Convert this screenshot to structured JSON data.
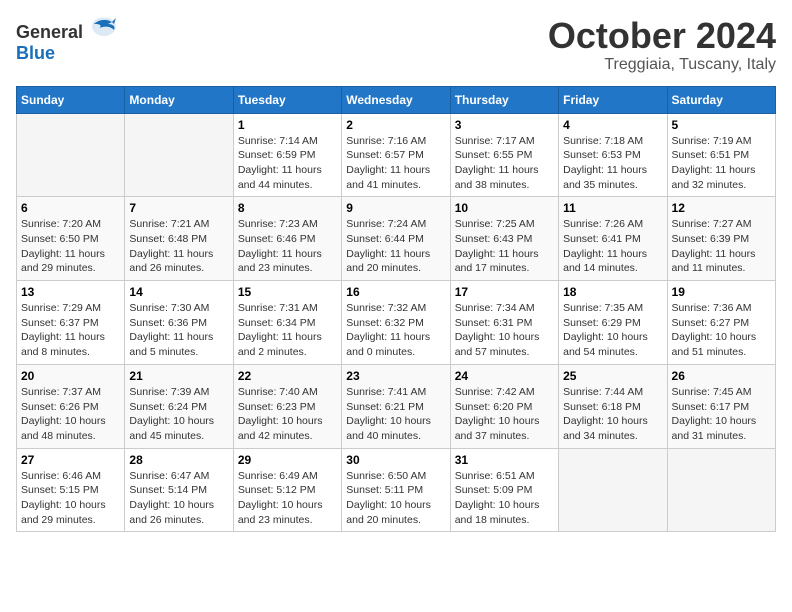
{
  "header": {
    "logo": {
      "general": "General",
      "blue": "Blue"
    },
    "month": "October 2024",
    "location": "Treggiaia, Tuscany, Italy"
  },
  "days_of_week": [
    "Sunday",
    "Monday",
    "Tuesday",
    "Wednesday",
    "Thursday",
    "Friday",
    "Saturday"
  ],
  "weeks": [
    [
      {
        "day": "",
        "info": ""
      },
      {
        "day": "",
        "info": ""
      },
      {
        "day": "1",
        "info": "Sunrise: 7:14 AM\nSunset: 6:59 PM\nDaylight: 11 hours and 44 minutes."
      },
      {
        "day": "2",
        "info": "Sunrise: 7:16 AM\nSunset: 6:57 PM\nDaylight: 11 hours and 41 minutes."
      },
      {
        "day": "3",
        "info": "Sunrise: 7:17 AM\nSunset: 6:55 PM\nDaylight: 11 hours and 38 minutes."
      },
      {
        "day": "4",
        "info": "Sunrise: 7:18 AM\nSunset: 6:53 PM\nDaylight: 11 hours and 35 minutes."
      },
      {
        "day": "5",
        "info": "Sunrise: 7:19 AM\nSunset: 6:51 PM\nDaylight: 11 hours and 32 minutes."
      }
    ],
    [
      {
        "day": "6",
        "info": "Sunrise: 7:20 AM\nSunset: 6:50 PM\nDaylight: 11 hours and 29 minutes."
      },
      {
        "day": "7",
        "info": "Sunrise: 7:21 AM\nSunset: 6:48 PM\nDaylight: 11 hours and 26 minutes."
      },
      {
        "day": "8",
        "info": "Sunrise: 7:23 AM\nSunset: 6:46 PM\nDaylight: 11 hours and 23 minutes."
      },
      {
        "day": "9",
        "info": "Sunrise: 7:24 AM\nSunset: 6:44 PM\nDaylight: 11 hours and 20 minutes."
      },
      {
        "day": "10",
        "info": "Sunrise: 7:25 AM\nSunset: 6:43 PM\nDaylight: 11 hours and 17 minutes."
      },
      {
        "day": "11",
        "info": "Sunrise: 7:26 AM\nSunset: 6:41 PM\nDaylight: 11 hours and 14 minutes."
      },
      {
        "day": "12",
        "info": "Sunrise: 7:27 AM\nSunset: 6:39 PM\nDaylight: 11 hours and 11 minutes."
      }
    ],
    [
      {
        "day": "13",
        "info": "Sunrise: 7:29 AM\nSunset: 6:37 PM\nDaylight: 11 hours and 8 minutes."
      },
      {
        "day": "14",
        "info": "Sunrise: 7:30 AM\nSunset: 6:36 PM\nDaylight: 11 hours and 5 minutes."
      },
      {
        "day": "15",
        "info": "Sunrise: 7:31 AM\nSunset: 6:34 PM\nDaylight: 11 hours and 2 minutes."
      },
      {
        "day": "16",
        "info": "Sunrise: 7:32 AM\nSunset: 6:32 PM\nDaylight: 11 hours and 0 minutes."
      },
      {
        "day": "17",
        "info": "Sunrise: 7:34 AM\nSunset: 6:31 PM\nDaylight: 10 hours and 57 minutes."
      },
      {
        "day": "18",
        "info": "Sunrise: 7:35 AM\nSunset: 6:29 PM\nDaylight: 10 hours and 54 minutes."
      },
      {
        "day": "19",
        "info": "Sunrise: 7:36 AM\nSunset: 6:27 PM\nDaylight: 10 hours and 51 minutes."
      }
    ],
    [
      {
        "day": "20",
        "info": "Sunrise: 7:37 AM\nSunset: 6:26 PM\nDaylight: 10 hours and 48 minutes."
      },
      {
        "day": "21",
        "info": "Sunrise: 7:39 AM\nSunset: 6:24 PM\nDaylight: 10 hours and 45 minutes."
      },
      {
        "day": "22",
        "info": "Sunrise: 7:40 AM\nSunset: 6:23 PM\nDaylight: 10 hours and 42 minutes."
      },
      {
        "day": "23",
        "info": "Sunrise: 7:41 AM\nSunset: 6:21 PM\nDaylight: 10 hours and 40 minutes."
      },
      {
        "day": "24",
        "info": "Sunrise: 7:42 AM\nSunset: 6:20 PM\nDaylight: 10 hours and 37 minutes."
      },
      {
        "day": "25",
        "info": "Sunrise: 7:44 AM\nSunset: 6:18 PM\nDaylight: 10 hours and 34 minutes."
      },
      {
        "day": "26",
        "info": "Sunrise: 7:45 AM\nSunset: 6:17 PM\nDaylight: 10 hours and 31 minutes."
      }
    ],
    [
      {
        "day": "27",
        "info": "Sunrise: 6:46 AM\nSunset: 5:15 PM\nDaylight: 10 hours and 29 minutes."
      },
      {
        "day": "28",
        "info": "Sunrise: 6:47 AM\nSunset: 5:14 PM\nDaylight: 10 hours and 26 minutes."
      },
      {
        "day": "29",
        "info": "Sunrise: 6:49 AM\nSunset: 5:12 PM\nDaylight: 10 hours and 23 minutes."
      },
      {
        "day": "30",
        "info": "Sunrise: 6:50 AM\nSunset: 5:11 PM\nDaylight: 10 hours and 20 minutes."
      },
      {
        "day": "31",
        "info": "Sunrise: 6:51 AM\nSunset: 5:09 PM\nDaylight: 10 hours and 18 minutes."
      },
      {
        "day": "",
        "info": ""
      },
      {
        "day": "",
        "info": ""
      }
    ]
  ]
}
